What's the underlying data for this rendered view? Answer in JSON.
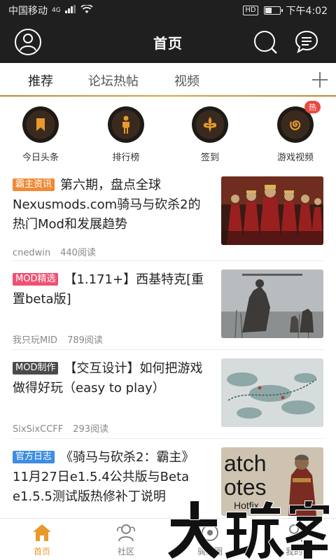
{
  "status_bar": {
    "carrier": "中国移动",
    "network": "4G",
    "hd": "HD",
    "time": "下午4:02",
    "battery_level": 0.45
  },
  "header": {
    "title": "首页",
    "icons": [
      "user-avatar-icon",
      "search-icon",
      "message-icon"
    ]
  },
  "tabs": [
    {
      "label": "推荐",
      "active": true
    },
    {
      "label": "论坛热帖",
      "active": false
    },
    {
      "label": "视频",
      "active": false
    }
  ],
  "shortcuts": [
    {
      "label": "今日头条",
      "icon": "bookmark-icon"
    },
    {
      "label": "排行榜",
      "icon": "person-icon"
    },
    {
      "label": "签到",
      "icon": "fleur-de-lis-icon"
    },
    {
      "label": "游戏视频",
      "icon": "spiral-icon",
      "badge": "热"
    }
  ],
  "articles": [
    {
      "tag": "霸主资讯",
      "title": "第六期，盘点全球Nexusmods.com骑马与砍杀2的热门Mod和发展趋势",
      "author": "cnedwin",
      "reads": "440阅读"
    },
    {
      "tag": "MOD精选",
      "title": "【1.171+】西基特克[重置beta版]",
      "author": "我只玩MID",
      "reads": "789阅读"
    },
    {
      "tag": "MOD制作",
      "title": "【交互设计】如何把游戏做得好玩（easy to play）",
      "author": "SixSixCCFF",
      "reads": "293阅读"
    },
    {
      "tag": "官方日志",
      "title": "《骑马与砍杀2：霸主》11月27日e1.5.4公共版与Beta e1.5.5测试版热修补丁说明",
      "author": "",
      "reads": ""
    }
  ],
  "thumb4_text": [
    "atch",
    "otes",
    "Hotfix"
  ],
  "bottom_nav": [
    {
      "label": "首页",
      "active": true
    },
    {
      "label": "社区",
      "active": false
    },
    {
      "label": "骑友圈",
      "active": false
    },
    {
      "label": "我的",
      "active": false
    }
  ],
  "watermark": "大玩家",
  "colors": {
    "accent": "#e89a2c",
    "header_bg": "#1f1f1f",
    "hot": "#e94b44"
  }
}
